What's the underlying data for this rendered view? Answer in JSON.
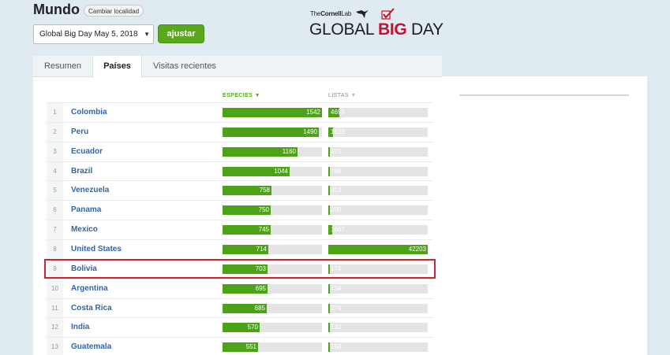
{
  "header": {
    "title": "Mundo",
    "change_location": "Cambiar localidad",
    "select_value": "Global Big Day May 5, 2018",
    "ajustar": "ajustar"
  },
  "brand": {
    "lab_prefix": "The",
    "lab_bold": "Cornell",
    "lab_suffix": "Lab",
    "gbd_global": "GLOBAL",
    "gbd_big": "BIG",
    "gbd_day": "DAY",
    "accent": "#c8102e"
  },
  "tabs": [
    {
      "label": "Resumen",
      "active": false
    },
    {
      "label": "Países",
      "active": true
    },
    {
      "label": "Visitas recientes",
      "active": false
    }
  ],
  "columns": {
    "species": "ESPECIES",
    "lists": "LISTAS"
  },
  "colors": {
    "bar_green": "#4da317",
    "link_blue": "#3264a8",
    "highlight_red": "#d2232a"
  },
  "rows": [
    {
      "rank": "1",
      "country": "Colombia",
      "species": "1542",
      "lists": "4699"
    },
    {
      "rank": "2",
      "country": "Peru",
      "species": "1490",
      "lists": "1929"
    },
    {
      "rank": "3",
      "country": "Ecuador",
      "species": "1160",
      "lists": "415"
    },
    {
      "rank": "4",
      "country": "Brazil",
      "species": "1044",
      "lists": "796"
    },
    {
      "rank": "5",
      "country": "Venezuela",
      "species": "758",
      "lists": "313"
    },
    {
      "rank": "6",
      "country": "Panama",
      "species": "750",
      "lists": "290"
    },
    {
      "rank": "7",
      "country": "Mexico",
      "species": "745",
      "lists": "1667"
    },
    {
      "rank": "8",
      "country": "United States",
      "species": "714",
      "lists": "42203"
    },
    {
      "rank": "9",
      "country": "Bolivia",
      "species": "703",
      "lists": "174",
      "highlighted": true
    },
    {
      "rank": "10",
      "country": "Argentina",
      "species": "695",
      "lists": "134"
    },
    {
      "rank": "11",
      "country": "Costa Rica",
      "species": "685",
      "lists": "374"
    },
    {
      "rank": "12",
      "country": "India",
      "species": "570",
      "lists": "132"
    },
    {
      "rank": "13",
      "country": "Guatemala",
      "species": "551",
      "lists": "168"
    }
  ]
}
